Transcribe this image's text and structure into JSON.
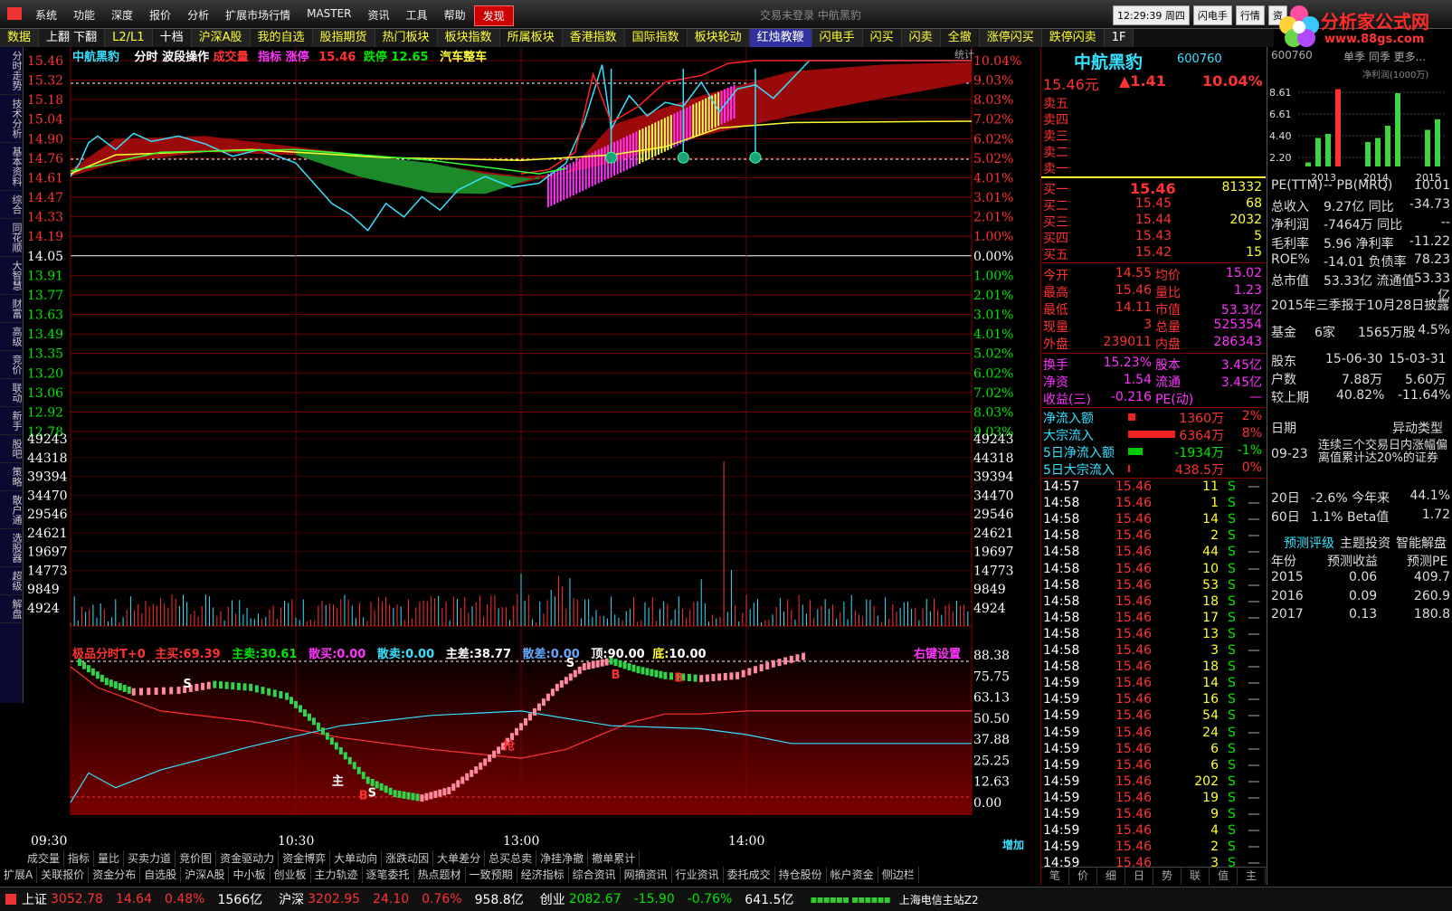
{
  "menu": {
    "items": [
      "系统",
      "功能",
      "深度",
      "报价",
      "分析",
      "扩展市场行情",
      "MASTER",
      "资讯",
      "工具",
      "帮助",
      "发现"
    ],
    "title": "交易未登录   中航黑豹",
    "clock": "12:29:39 周四",
    "btn1": "闪电手",
    "btn2": "行情",
    "btn3": "资"
  },
  "logo": {
    "text": "分析家公式网",
    "url": "www.88gs.com"
  },
  "tabs": [
    {
      "label": "数据",
      "color": "#ffff33"
    },
    {
      "label": "上翻 下翻",
      "color": "#fff"
    },
    {
      "label": "L2/L1",
      "color": "#ffff33"
    },
    {
      "label": "十档",
      "color": "#fff"
    },
    {
      "label": "沪深A股",
      "color": "#ffff33"
    },
    {
      "label": "我的自选",
      "color": "#ffff33"
    },
    {
      "label": "股指期货",
      "color": "#ffff33"
    },
    {
      "label": "热门板块",
      "color": "#ffff33"
    },
    {
      "label": "板块指数",
      "color": "#ffff33"
    },
    {
      "label": "所属板块",
      "color": "#ffff33"
    },
    {
      "label": "香港指数",
      "color": "#ffff33"
    },
    {
      "label": "国际指数",
      "color": "#ffff33"
    },
    {
      "label": "板块轮动",
      "color": "#ffff33"
    },
    {
      "label": "红烛教鞭",
      "color": "#fff"
    },
    {
      "label": "闪电手",
      "color": "#ffff33"
    },
    {
      "label": "闪买",
      "color": "#ffff33"
    },
    {
      "label": "闪卖",
      "color": "#ffff33"
    },
    {
      "label": "全撤",
      "color": "#ffff33"
    },
    {
      "label": "涨停闪买",
      "color": "#ffff33"
    },
    {
      "label": "跌停闪卖",
      "color": "#ffff33"
    },
    {
      "label": "1F",
      "color": "#fff"
    }
  ],
  "leftnav": [
    "分时走势",
    "技术分析",
    "基本资料",
    "综合",
    "同花顺",
    "大智慧",
    "财富",
    "高级",
    "竞价",
    "联动",
    "新手",
    "股吧",
    "策略",
    "散户通",
    "选股器",
    "超级",
    "解盘"
  ],
  "chart": {
    "name": "中航黑豹",
    "indicator": "分时 波段操作",
    "extra1": "成交量",
    "extra2": "指标 涨停",
    "limit_up": "15.46",
    "limit_down_label": "跌停",
    "limit_down": "12.65",
    "tag": "汽车整车",
    "stat": "统计",
    "price_axis": [
      "15.46",
      "15.32",
      "15.18",
      "15.04",
      "14.90",
      "14.76",
      "14.61",
      "14.47",
      "14.33",
      "14.19",
      "14.05",
      "13.91",
      "13.77",
      "13.63",
      "13.49",
      "13.35",
      "13.20",
      "13.06",
      "12.92",
      "12.78"
    ],
    "pct_axis": [
      "10.04%",
      "9.03%",
      "8.03%",
      "7.02%",
      "6.02%",
      "5.02%",
      "4.01%",
      "3.01%",
      "2.01%",
      "1.00%",
      "0.00%",
      "1.00%",
      "2.01%",
      "3.01%",
      "4.01%",
      "5.02%",
      "6.02%",
      "7.02%",
      "8.03%",
      "9.03%"
    ],
    "vol_axis": [
      "49243",
      "44318",
      "39394",
      "34470",
      "29546",
      "24621",
      "19697",
      "14773",
      "9849",
      "4924"
    ],
    "sub_axis": [
      "88.38",
      "75.75",
      "63.13",
      "50.50",
      "37.88",
      "25.25",
      "12.63",
      "0.00"
    ],
    "sub_header": {
      "t0": "极品分时T+0",
      "zm_l": "主买:",
      "zm": "69.39",
      "zs_l": "主卖:",
      "zs": "30.61",
      "sm_l": "散买:",
      "sm": "0.00",
      "ss_l": "散卖:",
      "ss": "0.00",
      "zc_l": "主差:",
      "zc": "38.77",
      "sc_l": "散差:",
      "sc": "0.00",
      "top_l": "顶:",
      "top": "90.00",
      "bot_l": "底:",
      "bot": "10.00",
      "right": "右键设置"
    },
    "time_labels": [
      "09:30",
      "10:30",
      "13:00",
      "14:00"
    ],
    "zoom": "增加",
    "marks": {
      "s1": "S",
      "s2": "S",
      "s3": "S",
      "b1": "B",
      "b2": "B",
      "b3": "B",
      "zhu": "主",
      "qiang": "抢"
    }
  },
  "bottom_tabs1": [
    "成交量",
    "指标",
    "量比",
    "买卖力道",
    "竞价图",
    "资金驱动力",
    "资金博弈",
    "大单动向",
    "涨跌动因",
    "大单差分",
    "总买总卖",
    "净挂净撤",
    "撤单累计"
  ],
  "bottom_tabs2": [
    "扩展A",
    "关联报价",
    "资金分布",
    "自选股",
    "沪深A股",
    "中小板",
    "创业板",
    "主力轨迹",
    "逐笔委托",
    "热点题材",
    "一致预期",
    "经济指标",
    "综合资讯",
    "网摘资讯",
    "行业资讯",
    "委托成交",
    "持仓股份",
    "帐户资金",
    "侧边栏"
  ],
  "quote": {
    "name": "中航黑豹",
    "code": "600760",
    "price": "15.46元",
    "chg": "▲1.41",
    "pct": "10.04%",
    "sells": [
      "卖五",
      "卖四",
      "卖三",
      "卖二",
      "卖一"
    ],
    "buys": [
      {
        "l": "买一",
        "p": "15.46",
        "v": "81332"
      },
      {
        "l": "买二",
        "p": "15.45",
        "v": "68"
      },
      {
        "l": "买三",
        "p": "15.44",
        "v": "2032"
      },
      {
        "l": "买四",
        "p": "15.43",
        "v": "5"
      },
      {
        "l": "买五",
        "p": "15.42",
        "v": "15"
      }
    ],
    "stats": [
      {
        "l1": "今开",
        "v1": "14.55",
        "l2": "均价",
        "v2": "15.02"
      },
      {
        "l1": "最高",
        "v1": "15.46",
        "l2": "量比",
        "v2": "1.23"
      },
      {
        "l1": "最低",
        "v1": "14.11",
        "l2": "市值",
        "v2": "53.3亿"
      },
      {
        "l1": "现量",
        "v1": "3",
        "l2": "总量",
        "v2": "525354"
      },
      {
        "l1": "外盘",
        "v1": "239011",
        "l2": "内盘",
        "v2": "286343"
      }
    ],
    "stats2": [
      {
        "l1": "换手",
        "v1": "15.23%",
        "l2": "股本",
        "v2": "3.45亿"
      },
      {
        "l1": "净资",
        "v1": "1.54",
        "l2": "流通",
        "v2": "3.45亿"
      },
      {
        "l1": "收益(三)",
        "v1": "-0.216",
        "l2": "PE(动)",
        "v2": "—"
      }
    ],
    "flows": [
      {
        "l": "净流入额",
        "v": "1360万",
        "p": "2%",
        "fill": 0.1
      },
      {
        "l": "大宗流入",
        "v": "6364万",
        "p": "8%",
        "fill": 0.65
      },
      {
        "l": "5日净流入额",
        "v": "-1934万",
        "p": "-1%",
        "fill": 0.2
      },
      {
        "l": "5日大宗流入",
        "v": "438.5万",
        "p": "0%",
        "fill": 0.03
      }
    ],
    "ticks": [
      [
        "14:57",
        "15.46",
        "11"
      ],
      [
        "14:58",
        "15.46",
        "1"
      ],
      [
        "14:58",
        "15.46",
        "14"
      ],
      [
        "14:58",
        "15.46",
        "2"
      ],
      [
        "14:58",
        "15.46",
        "44"
      ],
      [
        "14:58",
        "15.46",
        "10"
      ],
      [
        "14:58",
        "15.46",
        "53"
      ],
      [
        "14:58",
        "15.46",
        "18"
      ],
      [
        "14:58",
        "15.46",
        "17"
      ],
      [
        "14:58",
        "15.46",
        "13"
      ],
      [
        "14:58",
        "15.46",
        "3"
      ],
      [
        "14:58",
        "15.46",
        "18"
      ],
      [
        "14:59",
        "15.46",
        "14"
      ],
      [
        "14:59",
        "15.46",
        "16"
      ],
      [
        "14:59",
        "15.46",
        "54"
      ],
      [
        "14:59",
        "15.46",
        "24"
      ],
      [
        "14:59",
        "15.46",
        "6"
      ],
      [
        "14:59",
        "15.46",
        "6"
      ],
      [
        "14:59",
        "15.46",
        "202"
      ],
      [
        "14:59",
        "15.46",
        "19"
      ],
      [
        "14:59",
        "15.46",
        "9"
      ],
      [
        "14:59",
        "15.46",
        "4"
      ],
      [
        "14:59",
        "15.46",
        "2"
      ],
      [
        "14:59",
        "15.46",
        "3"
      ]
    ],
    "tick_flag": "S",
    "tick_dash": "—",
    "bottom_tabs": [
      "笔",
      "价",
      "细",
      "日",
      "势",
      "联",
      "值",
      "主"
    ]
  },
  "f10": {
    "code": "600760",
    "tabs": "单季 同季 更多...",
    "chart_title": "净利润(1000万)",
    "yticks": [
      "8.61",
      "6.61",
      "4.40",
      "2.20"
    ],
    "years": [
      "2013",
      "2014",
      "2015"
    ],
    "bars": [
      0.05,
      0.35,
      0.4,
      0.95,
      0,
      0,
      0.3,
      0.35,
      0.5,
      0.9,
      0,
      0,
      0.45,
      0.58
    ],
    "rows": [
      {
        "a": "PE(TTM)",
        "b": "-- PB(MRQ)",
        "c": "10.01"
      },
      {
        "a": "总收入",
        "b": "9.27亿 同比",
        "c": "-34.73"
      },
      {
        "a": "净利润",
        "b": "-7464万 同比",
        "c": "--"
      },
      {
        "a": "毛利率",
        "b": "5.96 净利率",
        "c": "-11.22"
      },
      {
        "a": "ROE%",
        "b": "-14.01 负债率",
        "c": "78.23"
      },
      {
        "a": "总市值",
        "b": "53.33亿 流通值",
        "c": "53.33亿"
      }
    ],
    "report": "2015年三季报于10月28日披露",
    "fund": "基金",
    "fund_n": "6家",
    "fund_v": "1565万股",
    "fund_p": "4.5%",
    "holders": {
      "h": "股东",
      "d1": "15-06-30",
      "d2": "15-03-31",
      "r1": "户数",
      "v1": "7.88万",
      "v2": "5.60万",
      "r2": "较上期",
      "p1": "40.82%",
      "p2": "-11.64%"
    },
    "event": {
      "h1": "日期",
      "h2": "异动类型",
      "date": "09-23",
      "desc": "连续三个交易日内涨幅偏离值累计达20%的证券"
    },
    "perf": [
      {
        "a": "20日",
        "b": "-2.6% 今年来",
        "c": "44.1%"
      },
      {
        "a": "60日",
        "b": "1.1% Beta值",
        "c": "1.72"
      }
    ],
    "fc_tabs": [
      "预测评级",
      "主题投资",
      "智能解盘"
    ],
    "fc_head": [
      "年份",
      "预测收益",
      "预测PE"
    ],
    "fc": [
      [
        "2015",
        "0.06",
        "409.7"
      ],
      [
        "2016",
        "0.09",
        "260.9"
      ],
      [
        "2017",
        "0.13",
        "180.8"
      ]
    ]
  },
  "status": {
    "sh_l": "上证",
    "sh": "3052.78",
    "sh_c": "14.64",
    "sh_p": "0.48%",
    "sh_a": "1566亿",
    "hs_l": "沪深",
    "hs": "3202.95",
    "hs_c": "24.10",
    "hs_p": "0.76%",
    "hs_a": "958.8亿",
    "cy_l": "创业",
    "cy": "2082.67",
    "cy_c": "-15.90",
    "cy_p": "-0.76%",
    "cy_a": "641.5亿",
    "server": "上海电信主站Z2"
  }
}
